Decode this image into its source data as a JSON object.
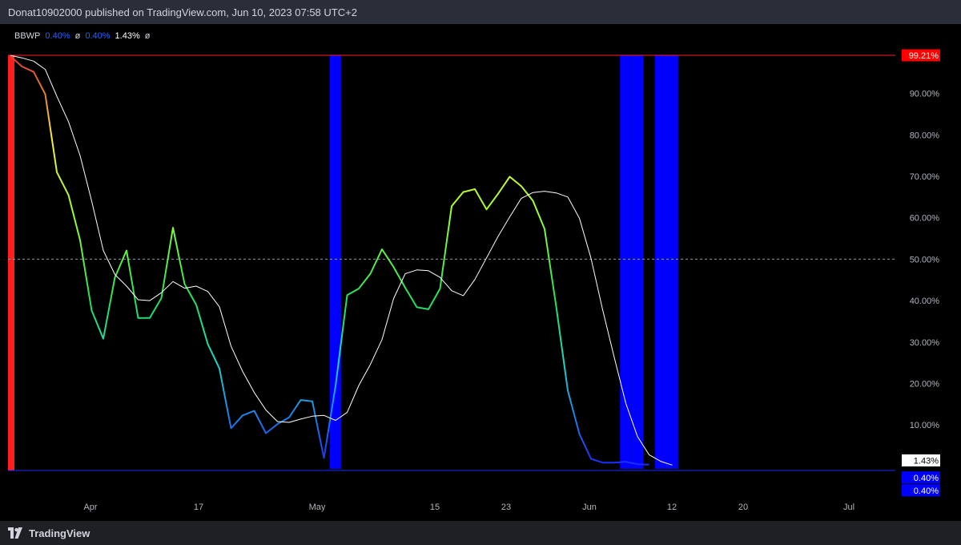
{
  "header": {
    "published_text": "Donat10902000 published on TradingView.com, Jun 10, 2023 07:58 UTC+2"
  },
  "legend": {
    "name": "BBWP",
    "value1": "0.40%",
    "sym1": "ø",
    "value2": "0.40%",
    "value3": "1.43%",
    "sym2": "ø"
  },
  "footer": {
    "brand": "TradingView"
  },
  "colors": {
    "background": "#000000",
    "ma_line": "#ffffff",
    "high_extreme": "#ff1e1e",
    "low_extreme": "#0000ff",
    "upper_line": "#b71c1c",
    "lower_line": "#1a2cff"
  },
  "chart_data": {
    "type": "line",
    "ylim": [
      -1,
      99.21
    ],
    "y_ticks": [
      "10.00%",
      "20.00%",
      "30.00%",
      "40.00%",
      "50.00%",
      "60.00%",
      "70.00%",
      "80.00%",
      "90.00%"
    ],
    "x_tick_labels": [
      "Apr",
      "17",
      "May",
      "15",
      "23",
      "Jun",
      "12",
      "20",
      "Jul"
    ],
    "reference_lines": [
      {
        "value": 99.21,
        "label": "99.21%",
        "style": "solid",
        "color": "#ff1e1e"
      },
      {
        "value": 50,
        "style": "dashed"
      },
      {
        "value": -1,
        "style": "solid",
        "color": "#1a2cff"
      }
    ],
    "price_labels": [
      {
        "value": 99.21,
        "text": "99.21%",
        "bg": "#ff0000",
        "fg": "#ffffff"
      },
      {
        "value": 1.43,
        "text": "1.43%",
        "bg": "#ffffff",
        "fg": "#000000"
      },
      {
        "value": 0.4,
        "text": "0.40%",
        "bg": "#0000ff",
        "fg": "#ffffff"
      },
      {
        "value": 0.4,
        "text": "0.40%",
        "bg": "#0000ff",
        "fg": "#ffffff"
      }
    ],
    "series": [
      {
        "role": "bbwp",
        "values": [
          99.0,
          96.5,
          95.2,
          89.8,
          71.0,
          65.5,
          54.6,
          37.6,
          30.8,
          45.6,
          52.1,
          35.8,
          35.8,
          40.6,
          57.6,
          44.0,
          39.0,
          29.5,
          23.6,
          9.2,
          12.3,
          13.4,
          8.0,
          10.2,
          11.8,
          16.0,
          15.7,
          2.0,
          19.4,
          41.3,
          42.9,
          46.5,
          52.4,
          48.1,
          43.1,
          38.4,
          37.9,
          42.9,
          62.8,
          66.2,
          66.9,
          62.0,
          65.8,
          69.9,
          67.6,
          64.1,
          57.3,
          38.6,
          18.3,
          7.8,
          1.8,
          0.9,
          0.9,
          1.1,
          0.5,
          0.4
        ]
      },
      {
        "role": "moving_average",
        "values": [
          99.2,
          98.6,
          97.8,
          95.8,
          89.3,
          83.2,
          75.0,
          64.0,
          52.1,
          46.3,
          43.5,
          40.2,
          40.0,
          41.9,
          44.6,
          43.0,
          43.5,
          42.2,
          38.5,
          29.0,
          22.9,
          17.8,
          13.6,
          10.8,
          10.6,
          11.4,
          12.1,
          12.3,
          11.1,
          13.0,
          19.5,
          24.6,
          30.6,
          40.5,
          46.5,
          47.4,
          47.2,
          45.6,
          42.4,
          41.2,
          45.1,
          50.3,
          55.5,
          60.2,
          64.7,
          66.1,
          66.4,
          66.0,
          65.0,
          59.9,
          50.2,
          37.8,
          26.3,
          15.2,
          7.2,
          2.8,
          1.2,
          0.3
        ]
      }
    ],
    "low_extreme_bars": [
      {
        "index": 28,
        "width": 1
      },
      {
        "index": 53,
        "width": 1
      },
      {
        "index": 54,
        "width": 1
      },
      {
        "index": 56,
        "width": 2
      }
    ],
    "high_extreme_bars": [
      {
        "index": 0,
        "width": 0.5
      }
    ]
  }
}
